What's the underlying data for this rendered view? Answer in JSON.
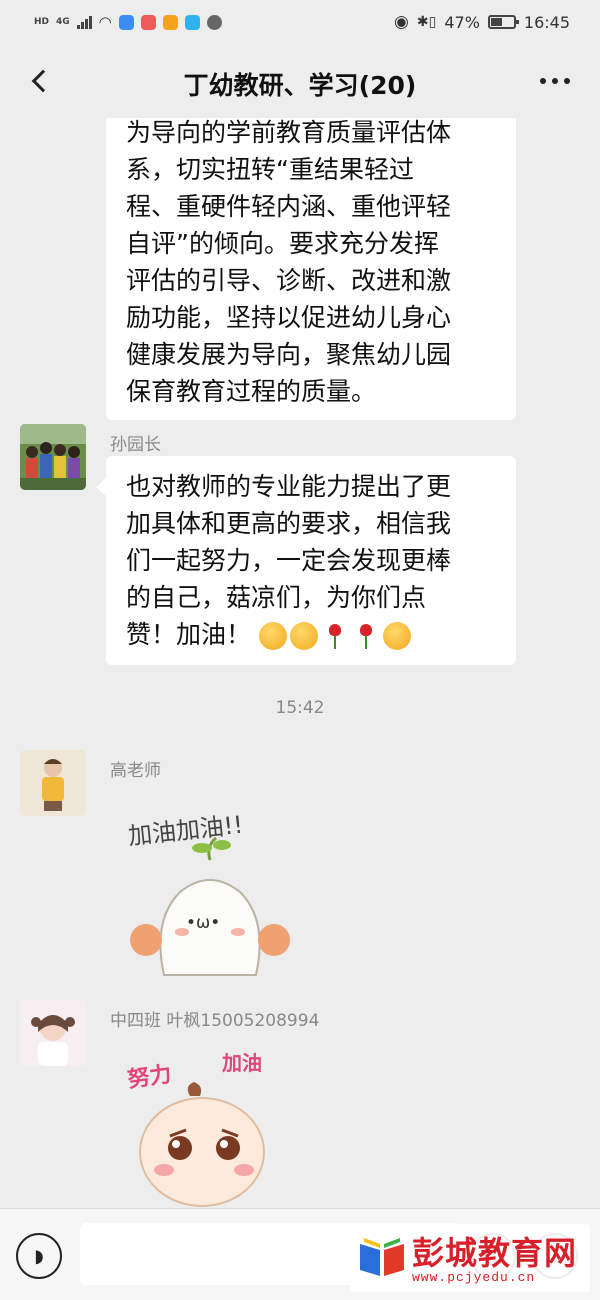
{
  "status_bar": {
    "hd": "HD",
    "network": "4G",
    "battery_percent": "47%",
    "time": "16:45"
  },
  "header": {
    "title": "丁幼教研、学习(20)",
    "back_icon": "back-arrow-icon",
    "more_icon": "more-dots-icon"
  },
  "messages": [
    {
      "lines": [
        "为导向的学前教育质量评估体",
        "系，切实扭转“重结果轻过",
        "程、重硬件轻内涵、重他评轻",
        "自评”的倾向。要求充分发挥",
        "评估的引导、诊断、改进和激",
        "励功能，坚持以促进幼儿身心",
        "健康发展为导向，聚焦幼儿园",
        "保育教育过程的质量。"
      ]
    },
    {
      "sender": "孙园长",
      "lines": [
        "也对教师的专业能力提出了更",
        "加具体和更高的要求，相信我",
        "们一起努力，一定会发现更棒",
        "的自己，菇凉们，为你们点",
        "赞！加油！"
      ],
      "emojis": [
        "hug-emoji",
        "hug-emoji",
        "rose-emoji",
        "rose-emoji",
        "strong-emoji"
      ]
    },
    {
      "timestamp": "15:42"
    },
    {
      "sender": "高老师",
      "sticker_text": "加油加油!!"
    },
    {
      "sender": "中四班  叶枫15005208994",
      "sticker_text_left": "努力",
      "sticker_text_right": "加油"
    }
  ],
  "input_bar": {
    "voice_icon": "voice-icon",
    "emoji_icon": "emoji-icon",
    "plus_icon": "plus-icon"
  },
  "watermark": {
    "title": "彭城教育网",
    "url": "www.pcjyedu.cn"
  },
  "colors": {
    "background": "#ededed",
    "bubble": "#ffffff",
    "watermark_red": "#d8202a"
  }
}
